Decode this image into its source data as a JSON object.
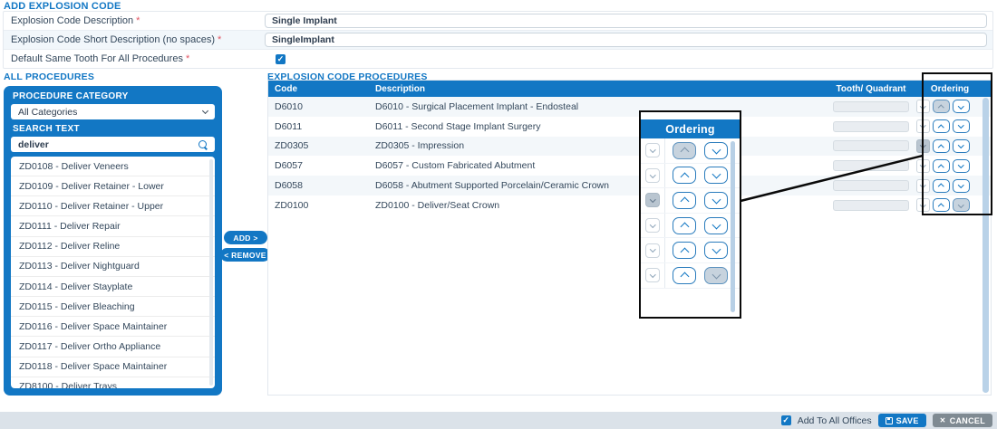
{
  "page": {
    "title": "ADD EXPLOSION CODE"
  },
  "form": {
    "required_mark": "*",
    "fields": [
      {
        "label": "Explosion Code Description",
        "value": "Single Implant"
      },
      {
        "label": "Explosion Code Short Description (no spaces)",
        "value": "SingleImplant"
      },
      {
        "label": "Default Same Tooth For All Procedures",
        "checked": true
      }
    ]
  },
  "all_procedures": {
    "title": "ALL PROCEDURES",
    "category_label": "PROCEDURE CATEGORY",
    "category_value": "All Categories",
    "search_label": "SEARCH TEXT",
    "search_value": "deliver",
    "items": [
      "ZD0108 - Deliver Veneers",
      "ZD0109 - Deliver Retainer - Lower",
      "ZD0110 - Deliver Retainer - Upper",
      "ZD0111 - Deliver Repair",
      "ZD0112 - Deliver Reline",
      "ZD0113 - Deliver Nightguard",
      "ZD0114 - Deliver Stayplate",
      "ZD0115 - Deliver Bleaching",
      "ZD0116 - Deliver Space Maintainer",
      "ZD0117 - Deliver Ortho Appliance",
      "ZD0118 - Deliver Space Maintainer",
      "ZD8100 - Deliver Trays"
    ]
  },
  "transfer": {
    "add_label": "ADD >",
    "remove_label": "< REMOVE"
  },
  "procedures_table": {
    "title": "EXPLOSION CODE PROCEDURES",
    "headers": {
      "code": "Code",
      "description": "Description",
      "tooth": "Tooth/ Quadrant",
      "ordering": "Ordering"
    },
    "rows": [
      {
        "code": "D6010",
        "description": "D6010 - Surgical Placement Implant - Endosteal",
        "tooth_quadrant": "",
        "ordering": {
          "select_disabled": false,
          "up_disabled": true,
          "down_disabled": false
        }
      },
      {
        "code": "D6011",
        "description": "D6011 - Second Stage Implant Surgery",
        "tooth_quadrant": "",
        "ordering": {
          "select_disabled": false,
          "up_disabled": false,
          "down_disabled": false
        }
      },
      {
        "code": "ZD0305",
        "description": "ZD0305 - Impression",
        "tooth_quadrant": "",
        "ordering": {
          "select_disabled": true,
          "up_disabled": false,
          "down_disabled": false
        }
      },
      {
        "code": "D6057",
        "description": "D6057 - Custom Fabricated Abutment",
        "tooth_quadrant": "",
        "ordering": {
          "select_disabled": false,
          "up_disabled": false,
          "down_disabled": false
        }
      },
      {
        "code": "D6058",
        "description": "D6058 - Abutment Supported Porcelain/Ceramic Crown",
        "tooth_quadrant": "",
        "ordering": {
          "select_disabled": false,
          "up_disabled": false,
          "down_disabled": false
        }
      },
      {
        "code": "ZD0100",
        "description": "ZD0100 - Deliver/Seat Crown",
        "tooth_quadrant": "",
        "ordering": {
          "select_disabled": false,
          "up_disabled": false,
          "down_disabled": true
        }
      }
    ]
  },
  "callout": {
    "title": "Ordering",
    "note": "magnified view of Ordering column"
  },
  "footer": {
    "offices_label": "Add To All Offices",
    "offices_checked": true,
    "save_label": "SAVE",
    "cancel_label": "CANCEL"
  },
  "icons": {
    "check_glyph": "✓",
    "cancel_glyph": "✕",
    "search": "magnifier",
    "category_chevron": "chevron-down",
    "move_up": "chevron-up",
    "move_down": "chevron-down",
    "save": "floppy-disk"
  },
  "colors": {
    "primary": "#1277c4",
    "label_text": "#33475b",
    "row_alt": "#f3f7fa",
    "form_row_alt": "#f2f7fb",
    "disabled_control_bg": "#c7d3de",
    "disabled_input_bg": "#e9edf1",
    "footer_bar": "#dbe2e9",
    "annotation": "#0a0a0a",
    "required": "#e25563",
    "scrollbar": "#b9d2e8",
    "cancel_button": "#7f8a92"
  }
}
